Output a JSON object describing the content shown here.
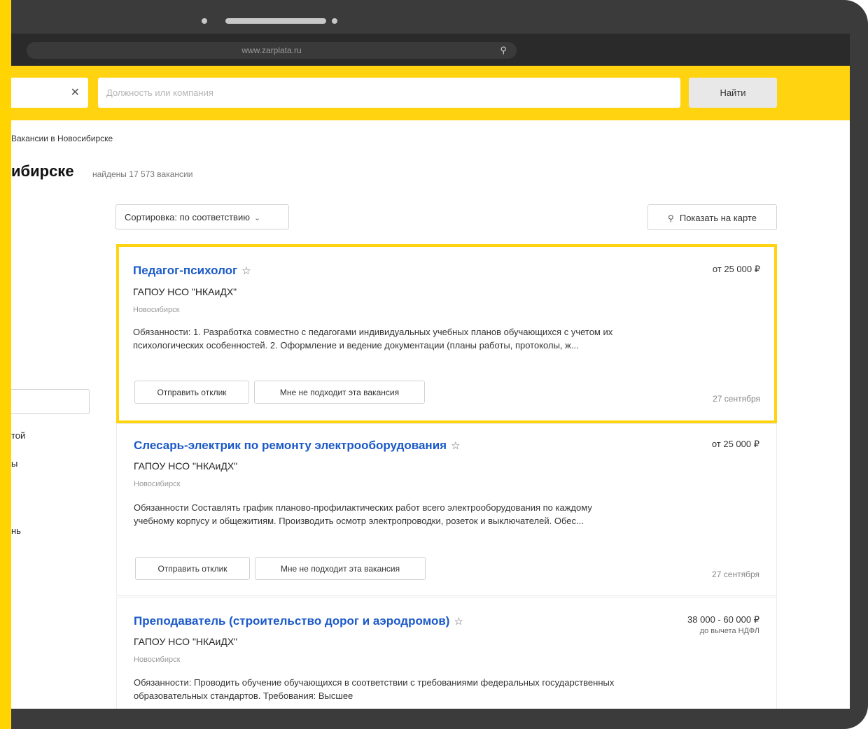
{
  "browser": {
    "url": "www.zarplata.ru"
  },
  "header": {
    "search_placeholder": "Должность или компания",
    "find_label": "Найти"
  },
  "breadcrumb": "Вакансии в Новосибирске",
  "page_title": "ибирске",
  "found_count": "найдены 17 573 вакансии",
  "toolbar": {
    "sort_label": "Сортировка: по соответствию",
    "map_label": "Показать на карте"
  },
  "sidebar": {
    "items": [
      "той",
      "ы",
      "нь"
    ]
  },
  "vacancies": [
    {
      "title": "Педагог-психолог",
      "company": "ГАПОУ НСО \"НКАиДХ\"",
      "location": "Новосибирск",
      "salary": "от 25 000 ₽",
      "salary_note": "",
      "description": "Обязанности: 1. Разработка совместно с педагогами индивидуальных учебных планов обучающихся с учетом их психологических особенностей. 2. Оформление и ведение документации (планы работы, протоколы, ж...",
      "respond_label": "Отправить отклик",
      "reject_label": "Мне не подходит эта вакансия",
      "date": "27 сентября"
    },
    {
      "title": "Слесарь-электрик по ремонту электрооборудования",
      "company": "ГАПОУ НСО \"НКАиДХ\"",
      "location": "Новосибирск",
      "salary": "от 25 000 ₽",
      "salary_note": "",
      "description": "Обязанности Составлять график планово-профилактических работ всего электрооборудования по каждому учебному корпусу и общежитиям. Производить осмотр электропроводки, розеток и выключателей. Обес...",
      "respond_label": "Отправить отклик",
      "reject_label": "Мне не подходит эта вакансия",
      "date": "27 сентября"
    },
    {
      "title": "Преподаватель (строительство дорог и аэродромов)",
      "company": "ГАПОУ НСО \"НКАиДХ\"",
      "location": "Новосибирск",
      "salary": "38 000 - 60 000 ₽",
      "salary_note": "до вычета НДФЛ",
      "description": "Обязанности: Проводить обучение обучающихся в соответствии с требованиями федеральных государственных образовательных стандартов. Требования: Высшее"
    }
  ]
}
